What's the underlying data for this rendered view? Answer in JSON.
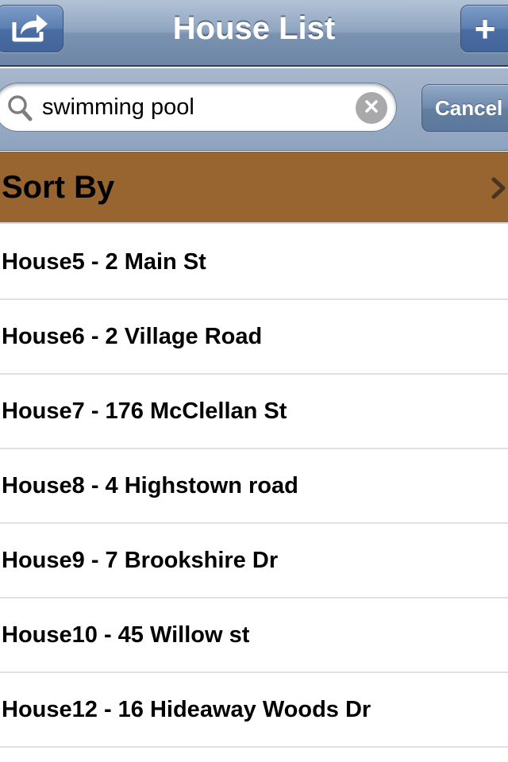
{
  "navbar": {
    "title": "House List",
    "left_icon": "share-icon",
    "right_icon": "plus-icon",
    "right_glyph": "+"
  },
  "search": {
    "value": "swimming pool",
    "icon": "search-icon",
    "clear_icon": "clear-icon",
    "cancel_label": "Cancel"
  },
  "sort": {
    "label": "Sort By",
    "icon": "chevron-right-icon",
    "background_color": "#986430"
  },
  "houses": [
    "House5 - 2 Main St",
    "House6 - 2 Village Road",
    "House7 - 176 McClellan St",
    "House8 - 4 Highstown road",
    "House9 - 7 Brookshire Dr",
    "House10 - 45 Willow st",
    "House12 - 16 Hideaway Woods Dr"
  ],
  "colors": {
    "navbar": "#7b93b1",
    "button": "#4a6da3",
    "sort_row": "#986430",
    "separator": "#e0e0e0"
  }
}
